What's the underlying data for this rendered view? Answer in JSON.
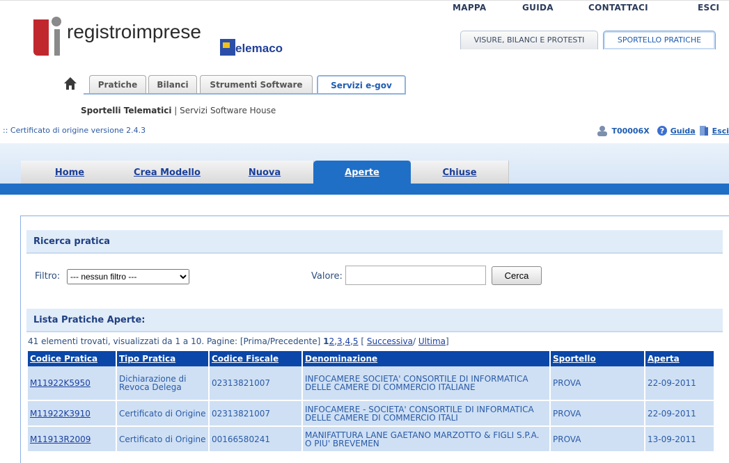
{
  "top_links": [
    "MAPPA",
    "GUIDA",
    "CONTATTACI",
    "ESCI"
  ],
  "logo": {
    "brand": "registroimprese",
    "telemaco": "elemaco"
  },
  "right_tabs": [
    {
      "label": "VISURE, BILANCI E PROTESTI",
      "active": false
    },
    {
      "label": "SPORTELLO PRATICHE",
      "active": true
    }
  ],
  "nav_tabs": [
    {
      "label": "Pratiche",
      "active": false
    },
    {
      "label": "Bilanci",
      "active": false
    },
    {
      "label": "Strumenti Software",
      "active": false
    },
    {
      "label": "Servizi e-gov",
      "active": true
    }
  ],
  "subnav": {
    "bold": "Sportelli Telematici",
    "separator": " | ",
    "other": "Servizi Software House"
  },
  "breadcrumb": ":: Certificato di origine versione 2.4.3",
  "user": {
    "code": "T00006X",
    "guida": "Guida",
    "esci": "Esci"
  },
  "main_tabs": [
    {
      "label": "Home",
      "active": false
    },
    {
      "label": "Crea Modello",
      "active": false
    },
    {
      "label": "Nuova",
      "active": false
    },
    {
      "label": "Aperte",
      "active": true
    },
    {
      "label": "Chiuse",
      "active": false
    }
  ],
  "search": {
    "title": "Ricerca pratica",
    "filter_label": "Filtro:",
    "filter_value": "--- nessun filtro ---",
    "value_label": "Valore:",
    "value_input": "",
    "button": "Cerca"
  },
  "list": {
    "title": "Lista Pratiche Aperte:",
    "summary": "41 elementi trovati, visualizzati da 1 a 10. Pagine: [Prima/Precedente]",
    "current_page": "1",
    "pages": [
      "2",
      "3",
      "4",
      "5"
    ],
    "next": "Successiva",
    "last": "Ultima",
    "columns": [
      "Codice Pratica",
      "Tipo Pratica",
      "Codice Fiscale",
      "Denominazione",
      "Sportello",
      "Aperta"
    ],
    "rows": [
      {
        "codice": "M11922K5950",
        "tipo": "Dichiarazione di Revoca Delega",
        "cf": "02313821007",
        "denominazione": "INFOCAMERE SOCIETA' CONSORTILE DI INFORMATICA DELLE CAMERE DI COMMERCIO ITALIANE",
        "sportello": "PROVA",
        "aperta": "22-09-2011"
      },
      {
        "codice": "M11922K3910",
        "tipo": "Certificato di Origine",
        "cf": "02313821007",
        "denominazione": "INFOCAMERE - SOCIETA' CONSORTILE DI INFORMATICA DELLE CAMERE DI COMMERCIO ITALI",
        "sportello": "PROVA",
        "aperta": "22-09-2011"
      },
      {
        "codice": "M11913R2009",
        "tipo": "Certificato di Origine",
        "cf": "00166580241",
        "denominazione": "MANIFATTURA LANE GAETANO MARZOTTO & FIGLI S.P.A. O PIU' BREVEMEN",
        "sportello": "PROVA",
        "aperta": "13-09-2011"
      }
    ]
  },
  "colors": {
    "accent": "#1f6fc7",
    "header_blue": "#0b47a8",
    "row_bg": "#cfe0f4",
    "logo_red": "#c0282d"
  }
}
